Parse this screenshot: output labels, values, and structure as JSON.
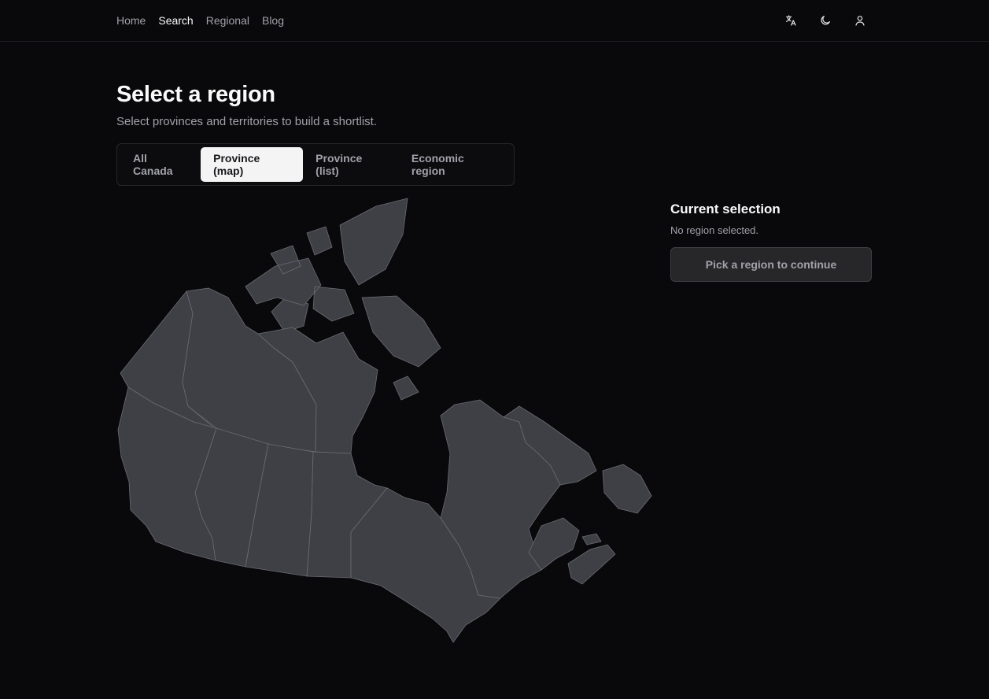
{
  "nav": {
    "items": [
      {
        "label": "Home",
        "active": false
      },
      {
        "label": "Search",
        "active": true
      },
      {
        "label": "Regional",
        "active": false
      },
      {
        "label": "Blog",
        "active": false
      }
    ]
  },
  "toolbar": {
    "icons": [
      "translate-icon",
      "moon-icon",
      "user-icon"
    ]
  },
  "page": {
    "title": "Select a region",
    "subtitle": "Select provinces and territories to build a shortlist."
  },
  "tabs": [
    {
      "label": "All Canada",
      "active": false
    },
    {
      "label": "Province (map)",
      "active": true
    },
    {
      "label": "Province (list)",
      "active": false
    },
    {
      "label": "Economic region",
      "active": false
    }
  ],
  "selection": {
    "heading": "Current selection",
    "empty_text": "No region selected.",
    "button_label": "Pick a region to continue"
  },
  "colors": {
    "background": "#09090b",
    "map_fill": "#3f3f46",
    "map_border": "#6b6b73",
    "active_tab": "#f4f4f5"
  }
}
